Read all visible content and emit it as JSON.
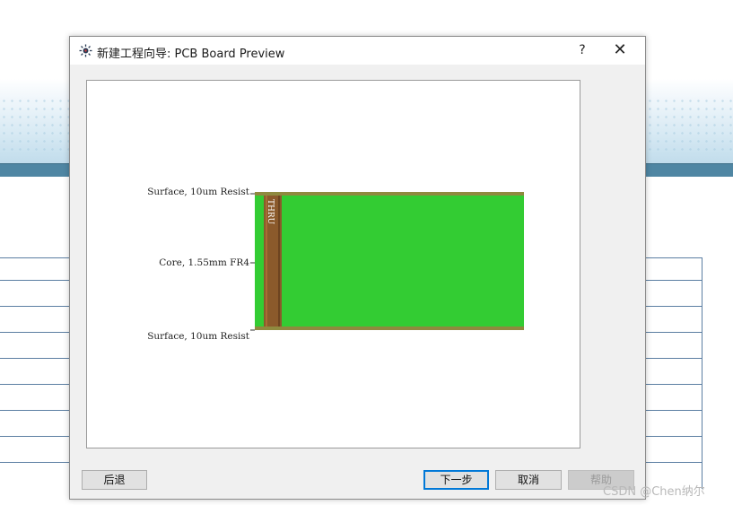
{
  "dialog": {
    "title": "新建工程向导: PCB Board Preview",
    "help_glyph": "?",
    "close_glyph": "✕"
  },
  "preview": {
    "layers": [
      "Surface, 10um Resist",
      "Core, 1.55mm FR4",
      "Surface, 10um Resist"
    ],
    "via_label": "THRU",
    "colors": {
      "board": "#33cc33",
      "copper": "#8b5a2b",
      "resist_edge": "#9aa55a"
    }
  },
  "buttons": {
    "back": "后退",
    "next": "下一步",
    "cancel": "取消",
    "help": "帮助"
  },
  "watermark": "CSDN @Chen纳尔"
}
